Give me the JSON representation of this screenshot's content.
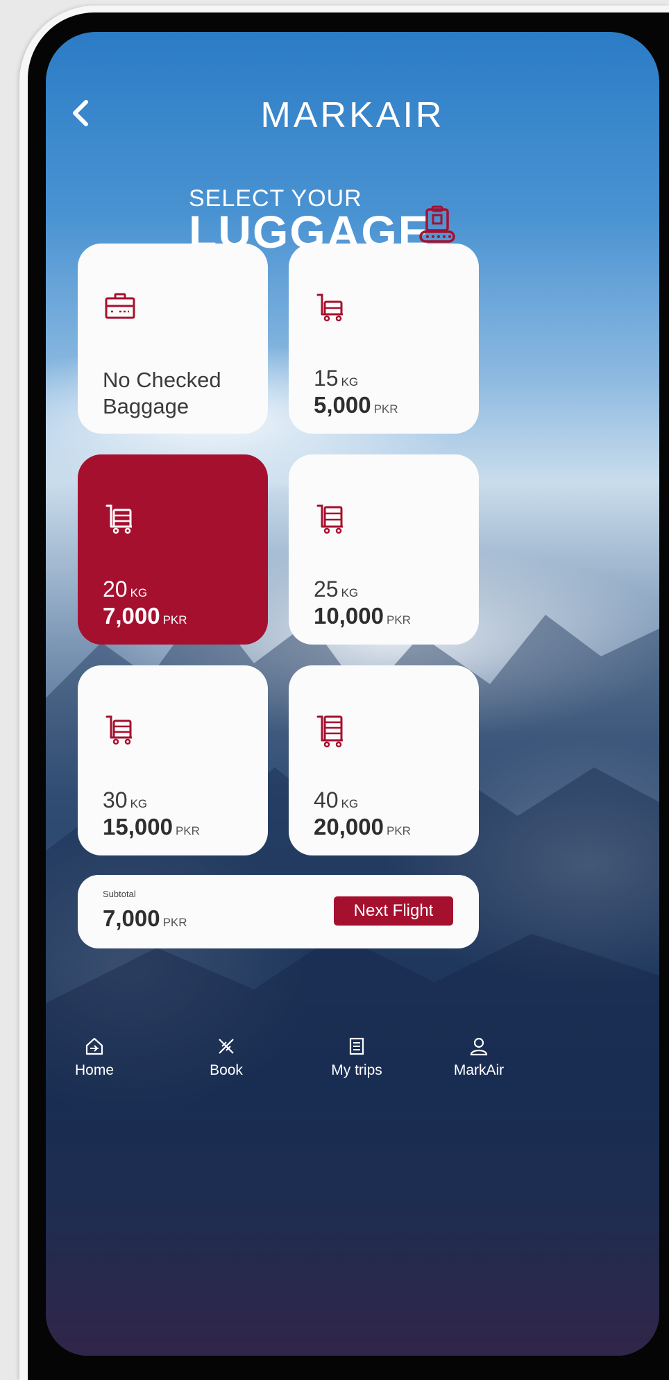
{
  "header": {
    "logo": "MARKAIR",
    "title_small": "SELECT YOUR",
    "title_big": "LUGGAGE"
  },
  "colors": {
    "brand": "#a6102f",
    "card": "#fbfbfb",
    "text": "#2e2e2e"
  },
  "options": [
    {
      "label_line1": "No Checked",
      "label_line2": "Baggage",
      "icon": "briefcase-icon"
    },
    {
      "kg": "15",
      "kg_unit": "KG",
      "price": "5,000",
      "currency": "PKR",
      "icon": "luggage-trolley-icon"
    },
    {
      "kg": "20",
      "kg_unit": "KG",
      "price": "7,000",
      "currency": "PKR",
      "icon": "luggage-trolley-icon",
      "selected": true
    },
    {
      "kg": "25",
      "kg_unit": "KG",
      "price": "10,000",
      "currency": "PKR",
      "icon": "luggage-trolley-icon"
    },
    {
      "kg": "30",
      "kg_unit": "KG",
      "price": "15,000",
      "currency": "PKR",
      "icon": "luggage-trolley-icon"
    },
    {
      "kg": "40",
      "kg_unit": "KG",
      "price": "20,000",
      "currency": "PKR",
      "icon": "luggage-trolley-icon"
    }
  ],
  "subtotal": {
    "label": "Subtotal",
    "price": "7,000",
    "currency": "PKR",
    "button": "Next Flight"
  },
  "nav": [
    {
      "label": "Home",
      "icon": "home-plane-icon"
    },
    {
      "label": "Book",
      "icon": "book-plane-icon"
    },
    {
      "label": "My trips",
      "icon": "trips-list-icon"
    },
    {
      "label": "MarkAir",
      "icon": "profile-icon"
    }
  ]
}
